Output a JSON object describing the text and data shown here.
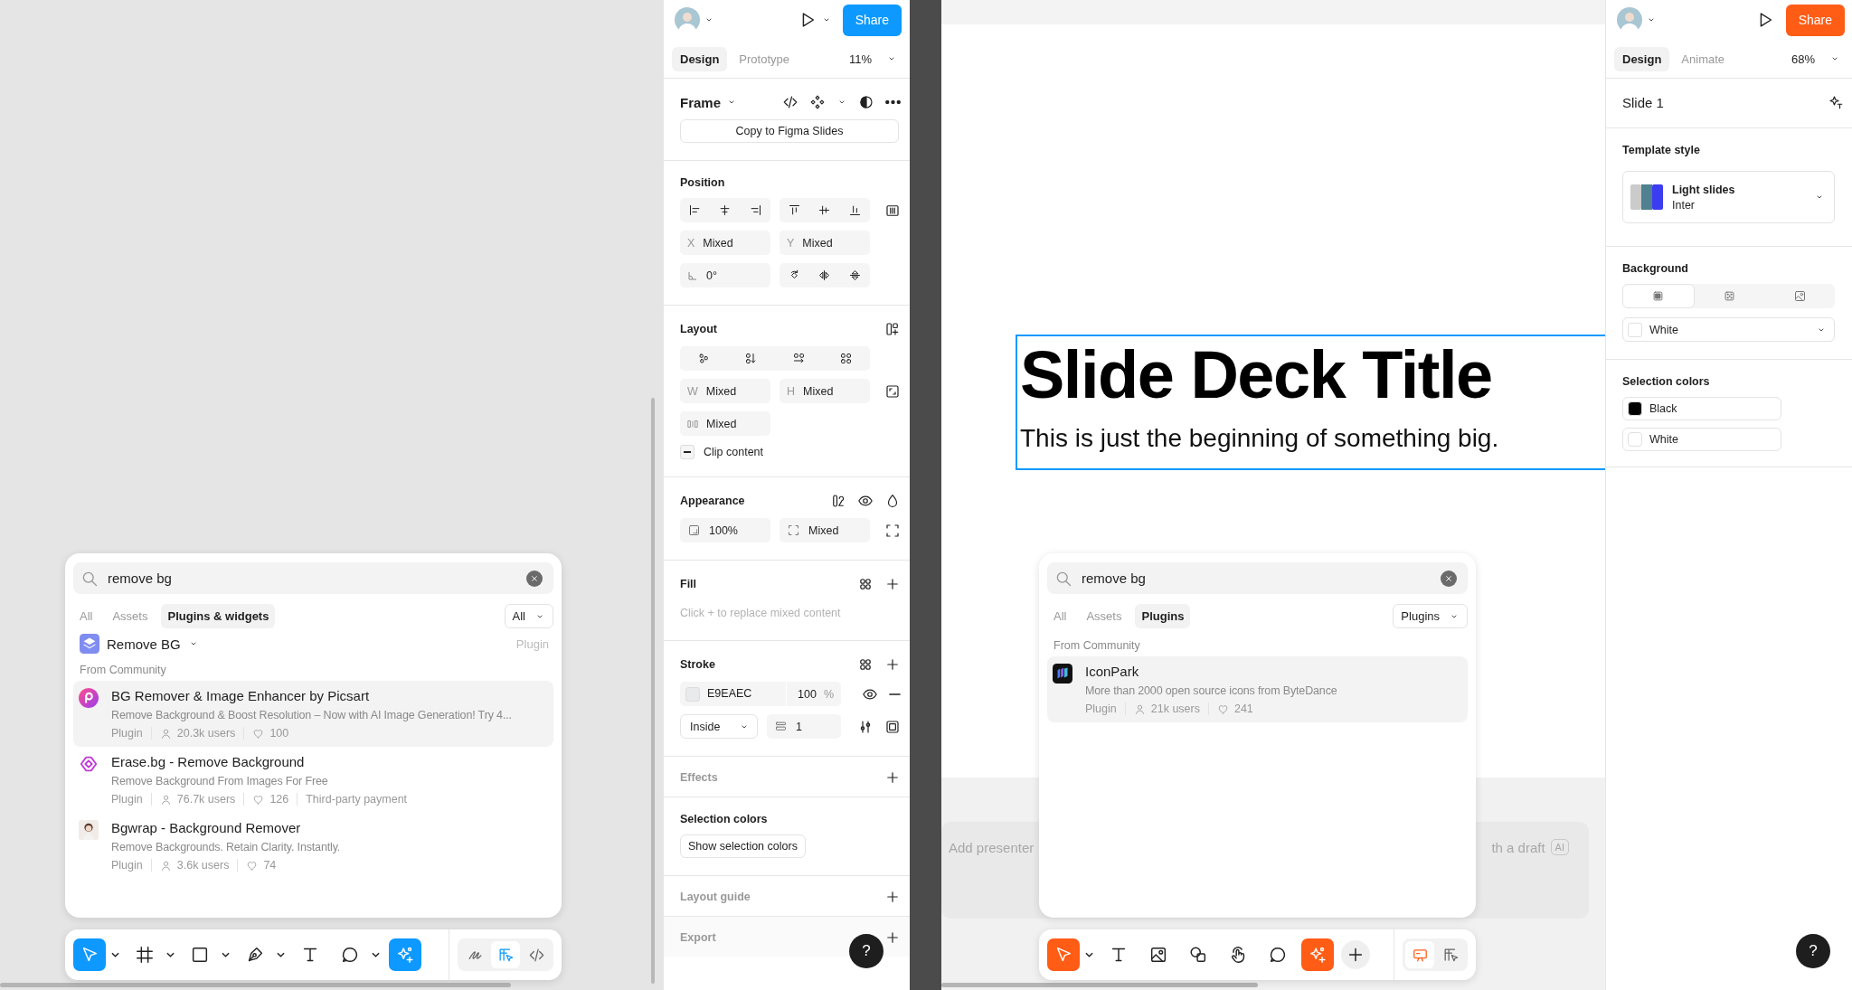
{
  "left_canvas": {
    "search_popup": {
      "search": {
        "value": "remove bg"
      },
      "tabs": [
        {
          "label": "All",
          "selected": false
        },
        {
          "label": "Assets",
          "selected": false
        },
        {
          "label": "Plugins & widgets",
          "selected": true
        }
      ],
      "filter": "All",
      "top_result": {
        "title": "Remove BG",
        "type": "Plugin"
      },
      "section_label": "From Community",
      "results": [
        {
          "kind": "gradient-circle",
          "title": "BG Remover & Image Enhancer by Picsart",
          "description": "Remove Background & Boost Resolution – Now with AI Image Generation! Try 4...",
          "type": "Plugin",
          "users": "20.3k users",
          "likes": "100",
          "selected": true
        },
        {
          "kind": "diamond",
          "title": "Erase.bg - Remove Background",
          "description": "Remove Background From Images For Free",
          "type": "Plugin",
          "users": "76.7k users",
          "likes": "126",
          "note": "Third-party payment",
          "selected": false
        },
        {
          "kind": "portrait",
          "title": "Bgwrap - Background Remover",
          "description": "Remove Backgrounds. Retain Clarity. Instantly.",
          "type": "Plugin",
          "users": "3.6k users",
          "likes": "74",
          "selected": false
        }
      ]
    },
    "toolbar": {
      "tools": [
        {
          "kind": "move",
          "menu": true,
          "selected": true
        },
        {
          "kind": "frame",
          "menu": true,
          "selected": false
        },
        {
          "kind": "rectangle",
          "menu": true,
          "selected": false
        },
        {
          "kind": "pen",
          "menu": true,
          "selected": false
        },
        {
          "kind": "text",
          "menu": false,
          "selected": false
        },
        {
          "kind": "comment",
          "menu": true,
          "selected": false
        },
        {
          "kind": "ai",
          "menu": false,
          "selected": true
        }
      ],
      "modes": [
        {
          "kind": "draw",
          "selected": false
        },
        {
          "kind": "dev-mode",
          "selected": true
        },
        {
          "kind": "code",
          "selected": false
        }
      ]
    }
  },
  "design_panel": {
    "share": "Share",
    "tabs": [
      {
        "label": "Design",
        "selected": true
      },
      {
        "label": "Prototype",
        "selected": false
      }
    ],
    "zoom": "11%",
    "selection_type": "Frame",
    "copy_button": "Copy to Figma Slides",
    "position": {
      "heading": "Position",
      "x": {
        "label": "X",
        "value": "Mixed"
      },
      "y": {
        "label": "Y",
        "value": "Mixed"
      },
      "rotation": "0°"
    },
    "layout": {
      "heading": "Layout",
      "w": {
        "label": "W",
        "value": "Mixed"
      },
      "h": {
        "label": "H",
        "value": "Mixed"
      },
      "gap": "Mixed",
      "clip_content": {
        "label": "Clip content",
        "indeterminate": true
      }
    },
    "appearance": {
      "heading": "Appearance",
      "opacity": "100%",
      "corner_radius": "Mixed"
    },
    "fill": {
      "heading": "Fill",
      "message": "Click + to replace mixed content"
    },
    "stroke": {
      "heading": "Stroke",
      "color": "E9EAEC",
      "opacity": "100",
      "unit": "%",
      "position": "Inside",
      "weight": "1"
    },
    "effects": "Effects",
    "selection_colors": {
      "heading": "Selection colors",
      "button": "Show selection colors"
    },
    "layout_guide": "Layout guide",
    "export": "Export",
    "help": "?"
  },
  "right_canvas": {
    "slide": {
      "title": "Slide Deck Title",
      "subtitle": "This is just the beginning of something big."
    },
    "notes": {
      "placeholder": "Add presenter",
      "action": "th a draft",
      "badge": "AI"
    },
    "search_popup": {
      "search": {
        "value": "remove bg"
      },
      "tabs": [
        {
          "label": "All",
          "selected": false
        },
        {
          "label": "Assets",
          "selected": false
        },
        {
          "label": "Plugins",
          "selected": true
        }
      ],
      "filter": "Plugins",
      "section_label": "From Community",
      "results": [
        {
          "kind": "dark-tile",
          "title": "IconPark",
          "description": "More than 2000 open source icons from ByteDance",
          "type": "Plugin",
          "users": "21k users",
          "likes": "241",
          "selected": true
        }
      ]
    },
    "toolbar": {
      "tools": [
        {
          "kind": "move",
          "menu": true,
          "selected": true
        },
        {
          "kind": "text",
          "menu": false,
          "selected": false
        },
        {
          "kind": "image",
          "menu": false,
          "selected": false
        },
        {
          "kind": "shapes",
          "menu": false,
          "selected": false
        },
        {
          "kind": "interaction",
          "menu": false,
          "selected": false
        },
        {
          "kind": "comment",
          "menu": false,
          "selected": false
        },
        {
          "kind": "ai",
          "menu": false,
          "selected": true
        },
        {
          "kind": "plus",
          "menu": false,
          "selected": false
        }
      ],
      "modes": [
        {
          "kind": "slides",
          "selected": true
        },
        {
          "kind": "dev-mode",
          "selected": false
        }
      ]
    },
    "help": "?"
  },
  "slides_panel": {
    "share": "Share",
    "tabs": [
      {
        "label": "Design",
        "selected": true
      },
      {
        "label": "Animate",
        "selected": false
      }
    ],
    "zoom": "68%",
    "slide_name": "Slide 1",
    "template": {
      "heading": "Template style",
      "name": "Light slides",
      "font": "Inter"
    },
    "background": {
      "heading": "Background",
      "modes": [
        {
          "kind": "solid",
          "selected": true
        },
        {
          "kind": "pattern",
          "selected": false
        },
        {
          "kind": "image",
          "selected": false
        }
      ],
      "value": "White"
    },
    "selection_colors": {
      "heading": "Selection colors",
      "items": [
        {
          "name": "Black",
          "color": "#000000"
        },
        {
          "name": "White",
          "color": "#ffffff"
        }
      ]
    }
  }
}
